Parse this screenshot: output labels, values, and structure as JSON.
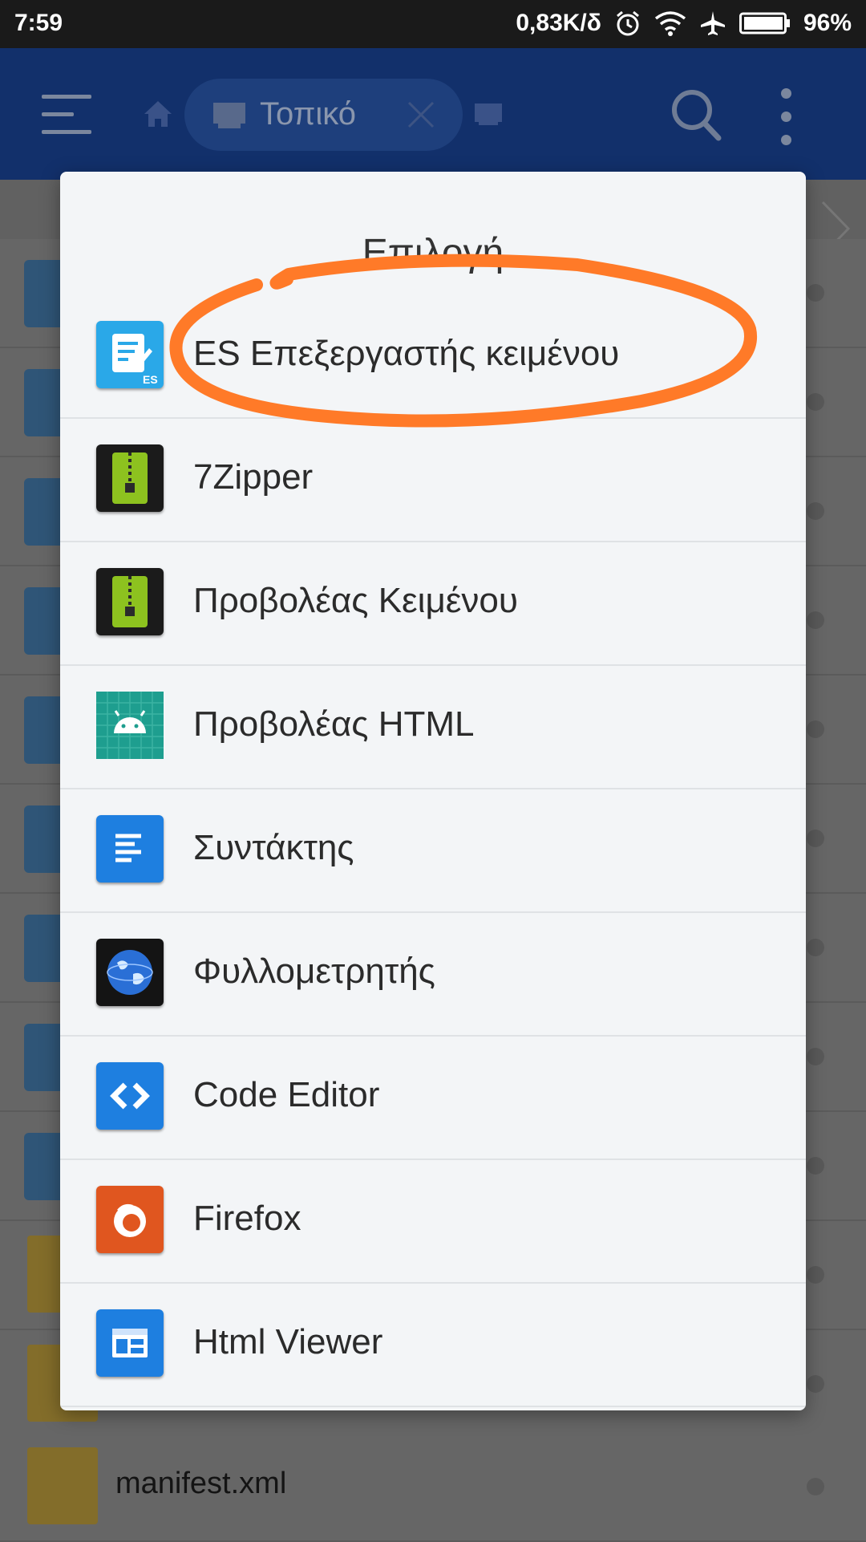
{
  "status_bar": {
    "time": "7:59",
    "network_speed": "0,83K/δ",
    "battery": "96%",
    "icons": [
      "alarm-icon",
      "wifi-icon",
      "airplane-icon",
      "battery-icon"
    ]
  },
  "toolbar": {
    "location_label": "Τοπικό",
    "icons": [
      "menu-icon",
      "home-icon",
      "sd-card-icon",
      "close-icon",
      "search-icon",
      "more-icon"
    ]
  },
  "file_list": {
    "visible_file_name": "manifest.xml"
  },
  "dialog": {
    "title": "Επιλογή",
    "items": [
      {
        "label": "ES Επεξεργαστής κειμένου",
        "icon": "es-text-editor-icon"
      },
      {
        "label": "7Zipper",
        "icon": "zipper-icon"
      },
      {
        "label": "Προβολέας Κειμένου",
        "icon": "zipper-icon"
      },
      {
        "label": "Προβολέας HTML",
        "icon": "android-icon"
      },
      {
        "label": "Συντάκτης",
        "icon": "document-editor-icon"
      },
      {
        "label": "Φυλλομετρητής",
        "icon": "globe-icon"
      },
      {
        "label": "Code Editor",
        "icon": "code-editor-icon"
      },
      {
        "label": "Firefox",
        "icon": "firefox-icon"
      },
      {
        "label": "Html Viewer",
        "icon": "html-viewer-icon"
      }
    ]
  },
  "colors": {
    "annotation": "#ff7a28",
    "toolbar": "#12306b",
    "dialog_bg": "#f3f5f7"
  }
}
